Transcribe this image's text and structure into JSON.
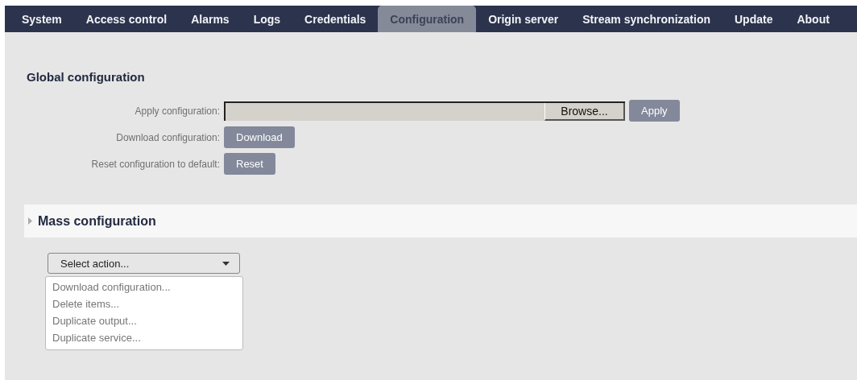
{
  "nav": {
    "tabs": [
      {
        "label": "System",
        "selected": false
      },
      {
        "label": "Access control",
        "selected": false
      },
      {
        "label": "Alarms",
        "selected": false
      },
      {
        "label": "Logs",
        "selected": false
      },
      {
        "label": "Credentials",
        "selected": false
      },
      {
        "label": "Configuration",
        "selected": true
      },
      {
        "label": "Origin server",
        "selected": false
      },
      {
        "label": "Stream synchronization",
        "selected": false
      },
      {
        "label": "Update",
        "selected": false
      },
      {
        "label": "About",
        "selected": false
      }
    ]
  },
  "global": {
    "title": "Global configuration",
    "rows": [
      {
        "kind": "file",
        "label": "Apply configuration:",
        "browse": "Browse...",
        "button": "Apply"
      },
      {
        "kind": "button",
        "label": "Download configuration:",
        "button": "Download"
      },
      {
        "kind": "button",
        "label": "Reset configuration to default:",
        "button": "Reset"
      }
    ]
  },
  "mass": {
    "title": "Mass configuration",
    "expanded": false,
    "select": {
      "value": "Select action...",
      "expanded": true,
      "options": [
        "Download configuration...",
        "Delete items...",
        "Duplicate output...",
        "Duplicate service..."
      ]
    }
  }
}
